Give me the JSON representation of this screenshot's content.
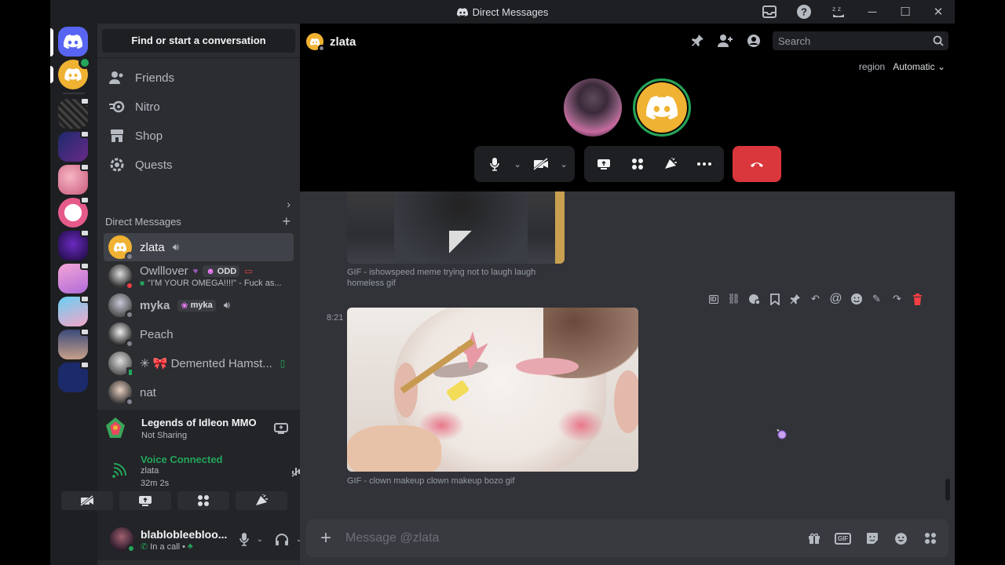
{
  "window": {
    "title": "Direct Messages",
    "controls": {
      "minimize": "─",
      "maximize": "☐",
      "close": "✕"
    }
  },
  "sidebar": {
    "find_placeholder": "Find or start a conversation",
    "nav": [
      {
        "label": "Friends",
        "icon": "friends-icon"
      },
      {
        "label": "Nitro",
        "icon": "nitro-icon"
      },
      {
        "label": "Shop",
        "icon": "shop-icon"
      },
      {
        "label": "Quests",
        "icon": "quests-icon"
      }
    ],
    "dm_header": "Direct Messages",
    "dms": [
      {
        "name": "zlata",
        "status": "offline",
        "active": true
      },
      {
        "name": "Owlllover",
        "tag": "ODD",
        "sub": "\"I'M YOUR OMEGA!!!!\" - Fuck as...",
        "status": "dnd"
      },
      {
        "name": "myka",
        "tag": "myka",
        "status": "offline"
      },
      {
        "name": "Peach",
        "status": "offline"
      },
      {
        "name": "✳ 🎀 Demented Hamst...",
        "status": "online"
      },
      {
        "name": "nat",
        "status": "offline"
      }
    ]
  },
  "activity": {
    "game": "Legends of Idleon MMO",
    "sub": "Not Sharing"
  },
  "voice": {
    "status": "Voice Connected",
    "channel": "zlata",
    "duration": "32m 2s"
  },
  "user": {
    "name": "blablobleebloo...",
    "status": "In a call •"
  },
  "call": {
    "dm_name": "zlata",
    "search_placeholder": "Search",
    "region_label": "region",
    "region_value": "Automatic"
  },
  "chat": {
    "gif1_caption": "GIF - ishowspeed meme trying not to laugh laugh homeless gif",
    "timestamp": "8:21",
    "gif2_caption": "GIF - clown makeup clown makeup bozo gif"
  },
  "composer": {
    "placeholder": "Message @zlata",
    "gif_label": "GIF"
  },
  "colors": {
    "blurple": "#5865f2",
    "hangup": "#da373c",
    "online": "#23a55a",
    "voice_green": "#23a55a"
  }
}
